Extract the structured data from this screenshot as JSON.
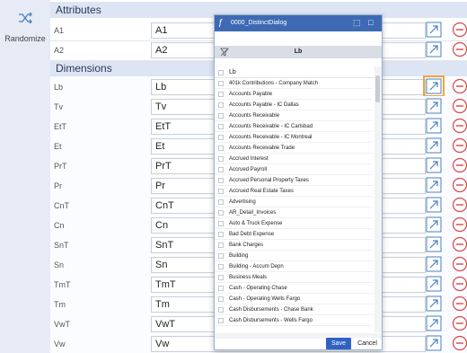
{
  "left_rail": {
    "randomize_label": "Randomize",
    "randomize_icon": "shuffle-icon"
  },
  "sections": {
    "attributes": "Attributes",
    "dimensions": "Dimensions"
  },
  "attribute_rows": [
    {
      "label": "A1",
      "value": "A1"
    },
    {
      "label": "A2",
      "value": "A2"
    }
  ],
  "dimension_rows": [
    {
      "label": "Lb",
      "value": "Lb"
    },
    {
      "label": "Tv",
      "value": "Tv"
    },
    {
      "label": "EtT",
      "value": "EtT"
    },
    {
      "label": "Et",
      "value": "Et"
    },
    {
      "label": "PrT",
      "value": "PrT"
    },
    {
      "label": "Pr",
      "value": "Pr"
    },
    {
      "label": "CnT",
      "value": "CnT"
    },
    {
      "label": "Cn",
      "value": "Cn"
    },
    {
      "label": "SnT",
      "value": "SnT"
    },
    {
      "label": "Sn",
      "value": "Sn"
    },
    {
      "label": "TmT",
      "value": "TmT"
    },
    {
      "label": "Tm",
      "value": "Tm"
    },
    {
      "label": "VwT",
      "value": "VwT"
    },
    {
      "label": "Vw",
      "value": "Vw"
    }
  ],
  "icons": {
    "link": "external-link-icon",
    "remove": "remove-circle-icon"
  },
  "colors": {
    "accent": "#3d6ab3",
    "remove": "#d8454a",
    "link": "#4a7fc1",
    "highlight": "#f1a43a"
  },
  "dialog": {
    "title": "0000_DistinctDialog",
    "header": "Lb",
    "column_header": "Lb",
    "items": [
      "401k Contributions - Company Match",
      "Accounts Payable",
      "Accounts Payable - IC Dallas",
      "Accounts Receivable",
      "Accounts Receivable - IC Carlsbad",
      "Accounts Receivable - IC Montreal",
      "Accounts Receivable Trade",
      "Accrued Interest",
      "Accrued Payroll",
      "Accrued Personal Property Taxes",
      "Accrued Real Estate Taxes",
      "Advertising",
      "AR_Detail_Invoices",
      "Auto & Truck Expense",
      "Bad Debt Expense",
      "Bank Charges",
      "Building",
      "Building - Accum Depn",
      "Business Meals",
      "Cash - Operating Chase",
      "Cash - Operating Wells Fargo",
      "Cash Disbursements - Chase Bank",
      "Cash Disbursements - Wells Fargo"
    ],
    "save_label": "Save",
    "cancel_label": "Cancel"
  }
}
